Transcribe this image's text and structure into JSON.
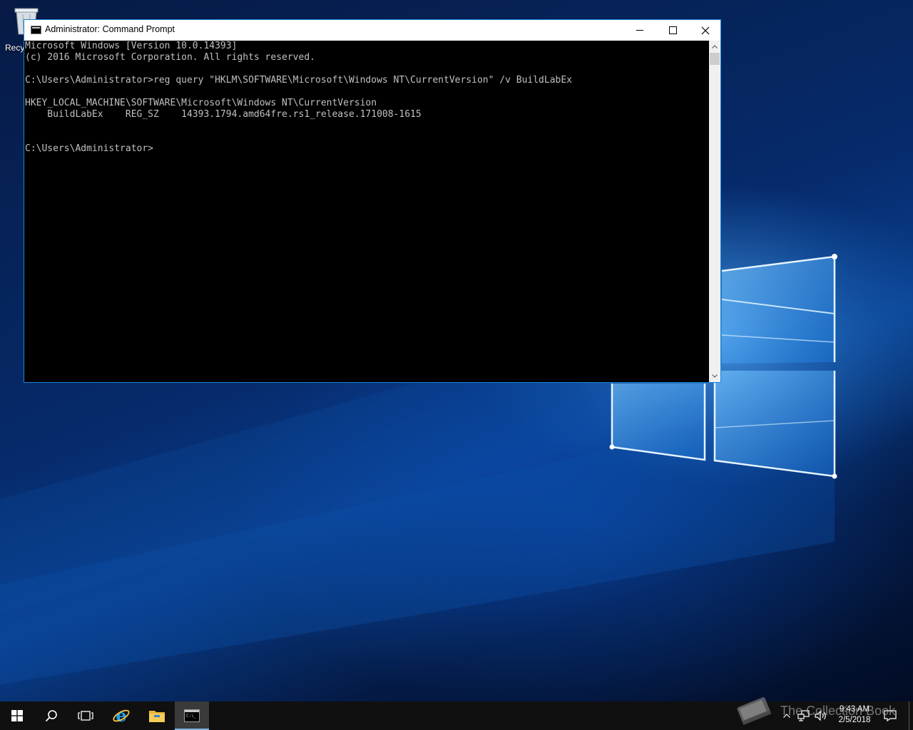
{
  "desktop": {
    "recycle_bin_label": "Recy"
  },
  "window": {
    "title": "Administrator: Command Prompt",
    "console_lines": [
      "Microsoft Windows [Version 10.0.14393]",
      "(c) 2016 Microsoft Corporation. All rights reserved.",
      "",
      "C:\\Users\\Administrator>reg query \"HKLM\\SOFTWARE\\Microsoft\\Windows NT\\CurrentVersion\" /v BuildLabEx",
      "",
      "HKEY_LOCAL_MACHINE\\SOFTWARE\\Microsoft\\Windows NT\\CurrentVersion",
      "    BuildLabEx    REG_SZ    14393.1794.amd64fre.rs1_release.171008-1615",
      "",
      "",
      "C:\\Users\\Administrator>"
    ]
  },
  "taskbar": {
    "items": [
      "start-icon",
      "search-icon",
      "task-view-icon",
      "internet-explorer-icon",
      "file-explorer-icon",
      "command-prompt-icon"
    ],
    "clock": {
      "time": "9:43 AM",
      "date": "2/5/2018"
    }
  },
  "watermark": {
    "text": "The Collection Book"
  },
  "colors": {
    "taskbar_bg": "#101010",
    "window_border": "#1883d7",
    "console_bg": "#000000",
    "console_fg": "#c0c0c0"
  }
}
